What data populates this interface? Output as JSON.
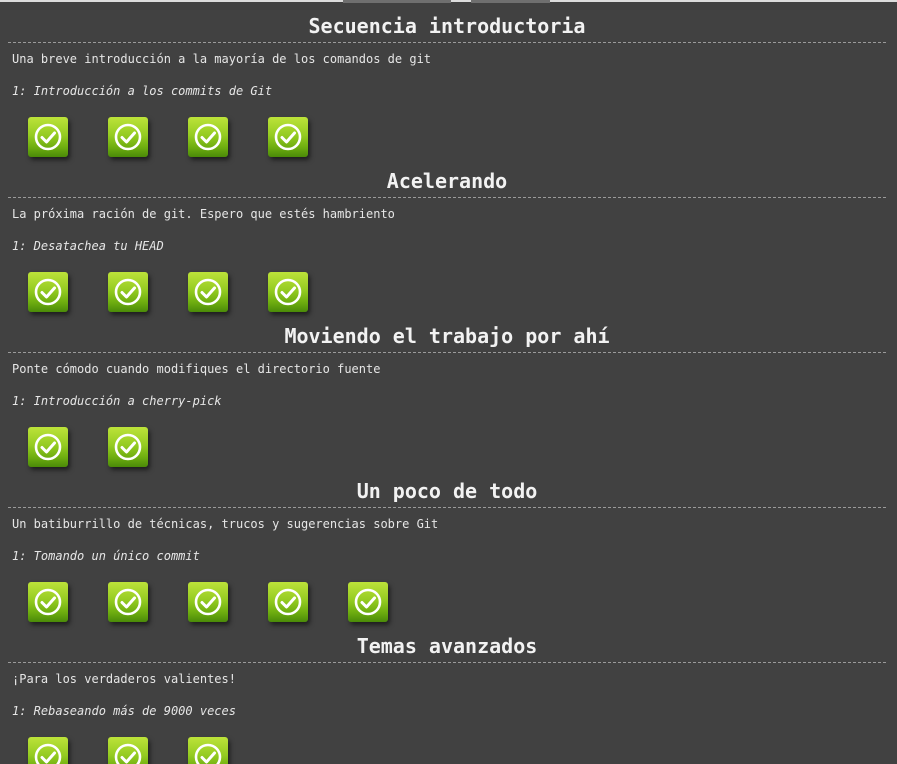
{
  "sequences": [
    {
      "id": "intro",
      "title": "Secuencia introductoria",
      "about": "Una breve introducción a la mayoría de los comandos de git",
      "level_name": "1: Introducción a los commits de Git",
      "levels": [
        {
          "status": "solved",
          "icon": "checkmark-icon"
        },
        {
          "status": "solved",
          "icon": "checkmark-icon"
        },
        {
          "status": "solved",
          "icon": "checkmark-icon"
        },
        {
          "status": "solved",
          "icon": "checkmark-icon"
        }
      ]
    },
    {
      "id": "rampup",
      "title": "Acelerando",
      "about": "La próxima ración de git. Espero que estés hambriento",
      "level_name": "1: Desatachea tu HEAD",
      "levels": [
        {
          "status": "solved",
          "icon": "checkmark-icon"
        },
        {
          "status": "solved",
          "icon": "checkmark-icon"
        },
        {
          "status": "solved",
          "icon": "checkmark-icon"
        },
        {
          "status": "solved",
          "icon": "checkmark-icon"
        }
      ]
    },
    {
      "id": "move",
      "title": "Moviendo el trabajo por ahí",
      "about": "Ponte cómodo cuando modifiques el directorio fuente",
      "level_name": "1: Introducción a cherry-pick",
      "levels": [
        {
          "status": "solved",
          "icon": "checkmark-icon"
        },
        {
          "status": "solved",
          "icon": "checkmark-icon"
        }
      ]
    },
    {
      "id": "mixed",
      "title": "Un poco de todo",
      "about": "Un batiburrillo de técnicas, trucos y sugerencias sobre Git",
      "level_name": "1: Tomando un único commit",
      "levels": [
        {
          "status": "solved",
          "icon": "checkmark-icon"
        },
        {
          "status": "solved",
          "icon": "checkmark-icon"
        },
        {
          "status": "solved",
          "icon": "checkmark-icon"
        },
        {
          "status": "solved",
          "icon": "checkmark-icon"
        },
        {
          "status": "solved",
          "icon": "checkmark-icon"
        }
      ]
    },
    {
      "id": "advanced",
      "title": "Temas avanzados",
      "about": "¡Para los verdaderos valientes!",
      "level_name": "1: Rebaseando más de 9000 veces",
      "levels": [
        {
          "status": "solved",
          "icon": "checkmark-icon"
        },
        {
          "status": "solved",
          "icon": "checkmark-icon"
        },
        {
          "status": "solved",
          "icon": "checkmark-icon"
        }
      ]
    }
  ],
  "colors": {
    "background": "#414141",
    "solved_green": "#95cc22",
    "text": "#e8e8e8"
  }
}
